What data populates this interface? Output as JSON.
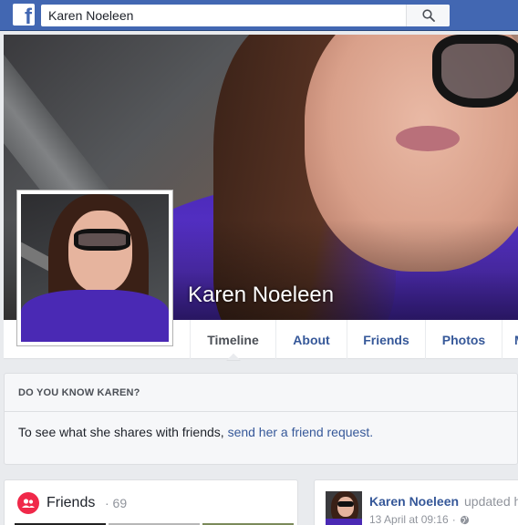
{
  "header": {
    "logo": "f",
    "search_value": "Karen Noeleen",
    "search_icon": "search-icon",
    "brand_color": "#4267b2"
  },
  "profile": {
    "name": "Karen Noeleen"
  },
  "tabs": [
    {
      "label": "Timeline",
      "active": true
    },
    {
      "label": "About"
    },
    {
      "label": "Friends"
    },
    {
      "label": "Photos"
    },
    {
      "label": "M"
    }
  ],
  "know": {
    "heading": "DO YOU KNOW KAREN?",
    "text": "To see what she shares with friends, ",
    "link": "send her a friend request."
  },
  "friends_card": {
    "title": "Friends",
    "count": "· 69",
    "icon": "friends-icon"
  },
  "post": {
    "author": "Karen Noeleen",
    "action": "updated h",
    "timestamp": "13 April at 09:16",
    "separator": "·",
    "privacy_icon": "globe-icon"
  }
}
